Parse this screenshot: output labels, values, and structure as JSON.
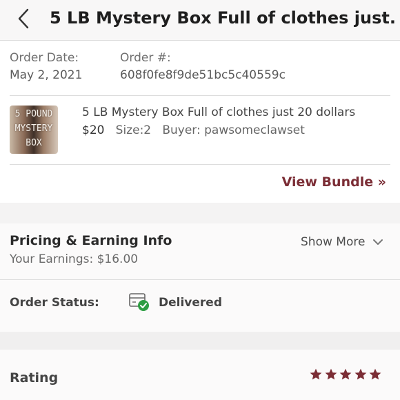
{
  "header": {
    "title": "5 LB Mystery Box Full of clothes just..."
  },
  "order": {
    "date_label": "Order Date:",
    "date_value": "May 2, 2021",
    "number_label": "Order #:",
    "number_value": "608f0fe8f9de51bc5c40559c"
  },
  "item": {
    "image_text": [
      "5 POUND",
      "MYSTERY",
      "BOX"
    ],
    "title": "5 LB Mystery Box Full of clothes just 20 dollars",
    "price": "$20",
    "size": "Size:2",
    "buyer": "Buyer: pawsomeclawset",
    "view_bundle": "View Bundle »"
  },
  "pricing": {
    "title": "Pricing & Earning Info",
    "earnings": "Your Earnings: $16.00",
    "show_more": "Show More"
  },
  "status": {
    "label": "Order Status:",
    "value": "Delivered"
  },
  "rating": {
    "label": "Rating",
    "stars": 5,
    "max_stars": 5
  },
  "colors": {
    "accent": "#7b2d35",
    "delivered_check": "#2f9e44"
  }
}
